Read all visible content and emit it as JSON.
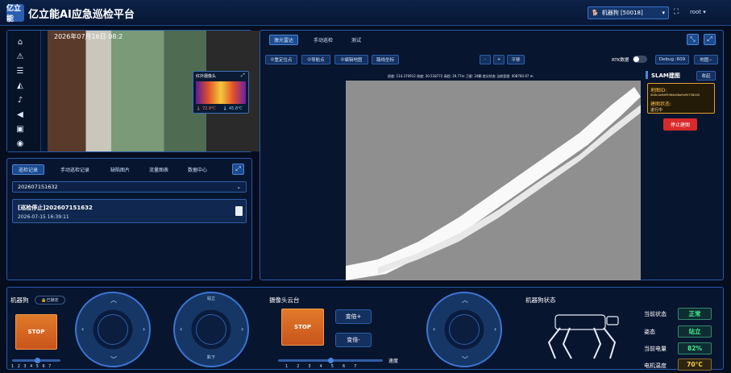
{
  "header": {
    "logo_text": "亿立能",
    "title": "亿立能AI应急巡检平台",
    "dog_selector": "机器狗 [50018]",
    "user": "root"
  },
  "video": {
    "timestamp": "2026年07月16日  08:2",
    "ir_title": "红外摄像头",
    "ir_max": "72.9℃",
    "ir_min": "45.8℃"
  },
  "records": {
    "tabs": [
      "巡检记录",
      "手动巡检记录",
      "缺陷图片",
      "流量图表",
      "数据中心"
    ],
    "selected": "202607151632",
    "item_title": "[巡检停止]202607151632",
    "item_time": "2026-07-15 16:39:11"
  },
  "map": {
    "tabs": [
      "激光雷达",
      "手动巡检",
      "测试"
    ],
    "tools": [
      "重定位点",
      "导航点",
      "编辑地图",
      "路线坐标"
    ],
    "nav_buttons": [
      "-",
      "+",
      "平移"
    ],
    "rtk_label": "RTK数据",
    "debug_label": "Debug :609",
    "map_select": "地图",
    "coords": "经度: 114.370912  纬度: 30.518772  高程: 29.77m  卫星: 24颗  差分状态  当前里程: 008760.97 m",
    "slam": {
      "title": "SLAM建图",
      "collapse": "收起",
      "map_id_label": "地图ID:",
      "map_id": "0b6c1a6499964e08a9a90736240",
      "status_label": "建图状态:",
      "status": "进行中",
      "stop_button": "停止建图"
    }
  },
  "bottom": {
    "dog_label": "机器狗",
    "lock_label": "已锁定",
    "stop_label": "STOP",
    "gimbal_label": "摄像头云台",
    "zoom_in": "变倍+",
    "zoom_out": "变倍-",
    "speed_label": "速度",
    "joy_top": "站立",
    "joy_bottom": "趴下",
    "scale_dog": [
      "1",
      "2",
      "3",
      "4",
      "5",
      "6",
      "7"
    ],
    "scale_speed": [
      "1",
      "2",
      "3",
      "4",
      "5",
      "6",
      "7"
    ],
    "status_title": "机器狗状态",
    "status": [
      {
        "label": "当前状态",
        "value": "正常"
      },
      {
        "label": "姿态",
        "value": "站立"
      },
      {
        "label": "当前电量",
        "value": "82%"
      },
      {
        "label": "电机温度",
        "value": "70°C"
      }
    ]
  }
}
